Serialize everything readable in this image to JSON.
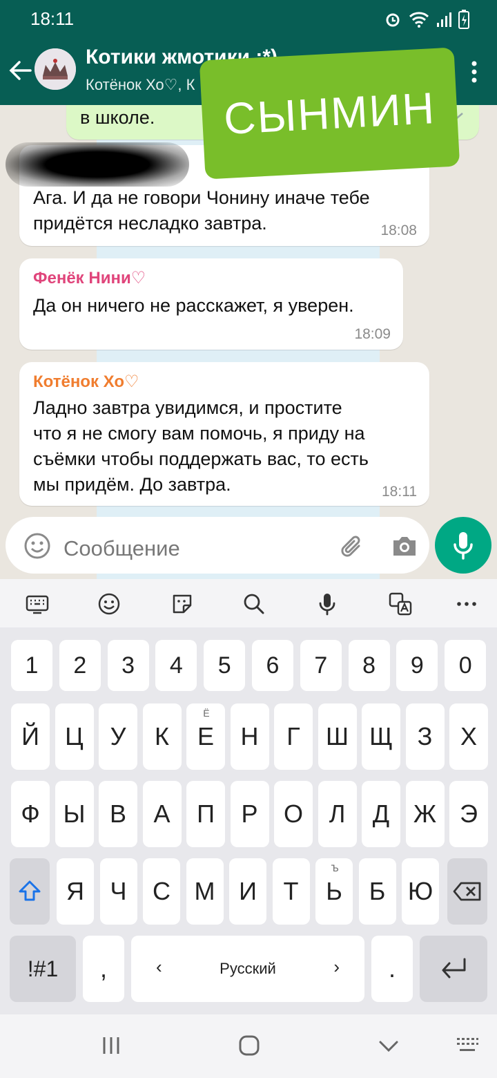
{
  "status": {
    "time": "18:11"
  },
  "header": {
    "title": "Котики жмотики :*)",
    "subtitle": "Котёнок Хо♡, К"
  },
  "messages": {
    "out_partial": "в школе.",
    "m1": {
      "lines": [
        "Ага. И да не говори Чонину иначе тебе",
        "придётся несладко завтра."
      ],
      "time": "18:08"
    },
    "m2": {
      "sender": "Фенёк Нини♡",
      "sender_color": "#e0457b",
      "lines": [
        "Да он ничего не расскажет, я уверен."
      ],
      "time": "18:09"
    },
    "m3": {
      "sender": "Котёнок Хо♡",
      "sender_color": "#f07d2f",
      "lines": [
        "Ладно завтра увидимся, и простите",
        "что я не смогу вам помочь, я приду на",
        "съёмки чтобы поддержать вас, то есть",
        "мы придём. До завтра."
      ],
      "time": "18:11"
    }
  },
  "sticker": {
    "text": "СЫНМИН"
  },
  "composer": {
    "placeholder": "Сообщение"
  },
  "keyboard": {
    "digits": [
      "1",
      "2",
      "3",
      "4",
      "5",
      "6",
      "7",
      "8",
      "9",
      "0"
    ],
    "row1": [
      "Й",
      "Ц",
      "У",
      "К",
      "Е",
      "Н",
      "Г",
      "Ш",
      "Щ",
      "З",
      "Х"
    ],
    "row1_hint": "Ё",
    "row2": [
      "Ф",
      "Ы",
      "В",
      "А",
      "П",
      "Р",
      "О",
      "Л",
      "Д",
      "Ж",
      "Э"
    ],
    "row3": [
      "Я",
      "Ч",
      "С",
      "М",
      "И",
      "Т",
      "Ь",
      "Б",
      "Ю"
    ],
    "row3_hint": "Ъ",
    "symbols": "!#1",
    "comma": ",",
    "space": "Русский",
    "period": ".",
    "left_arrow": "‹",
    "right_arrow": "›"
  },
  "colors": {
    "header": "#075e54",
    "accent": "#00a884",
    "sticker": "#79be2a"
  }
}
